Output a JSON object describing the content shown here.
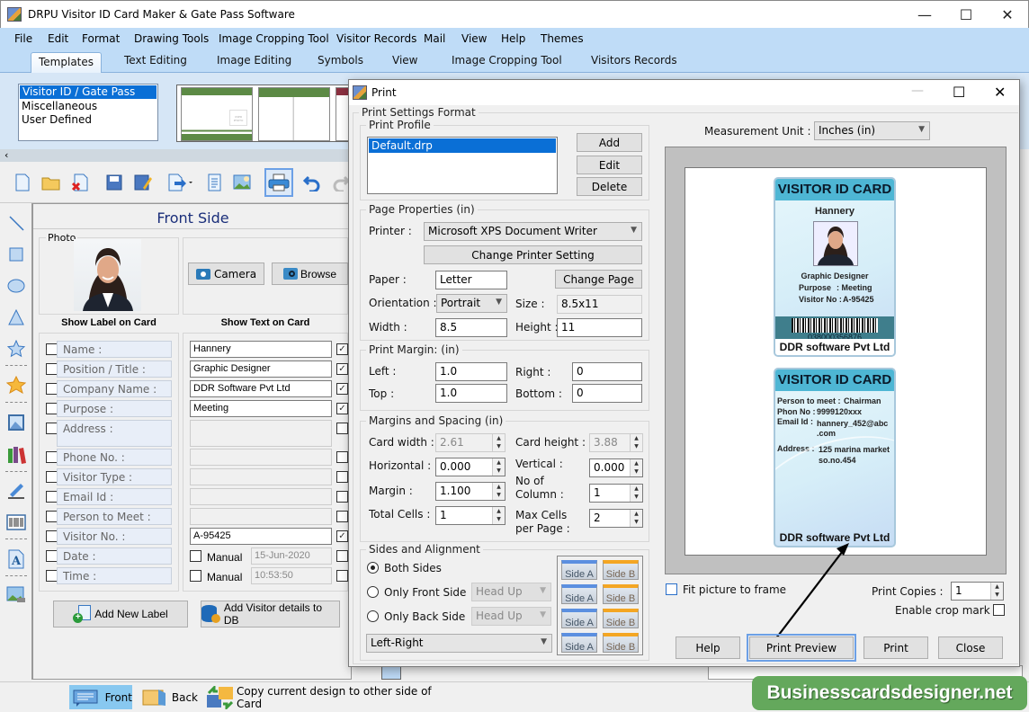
{
  "app": {
    "title": "DRPU Visitor ID Card Maker & Gate Pass Software",
    "window_controls": {
      "minimize": "—",
      "maximize": "☐",
      "close": "✕"
    }
  },
  "menu": [
    "File",
    "Edit",
    "Format",
    "Drawing Tools",
    "Image Cropping Tool",
    "Visitor Records",
    "Mail",
    "View",
    "Help",
    "Themes"
  ],
  "tabs": [
    {
      "label": "Templates",
      "active": true
    },
    {
      "label": "Text Editing"
    },
    {
      "label": "Image Editing"
    },
    {
      "label": "Symbols"
    },
    {
      "label": "View"
    },
    {
      "label": "Image Cropping Tool"
    },
    {
      "label": "Visitors Records"
    }
  ],
  "templates": {
    "categories": [
      "Visitor ID / Gate Pass",
      "Miscellaneous",
      "User Defined"
    ],
    "selected": "Visitor ID / Gate Pass",
    "thumb_text": "USER PHOTO"
  },
  "toolbar": [
    "new-icon",
    "open-icon",
    "close-doc-icon",
    "save-icon",
    "save-as-icon",
    "export-icon",
    "properties-icon",
    "image-icon",
    "print-icon",
    "undo-icon",
    "redo-icon"
  ],
  "left_tools": [
    "line-icon",
    "rectangle-icon",
    "ellipse-icon",
    "triangle-icon",
    "star-icon",
    "symbol-icon",
    "picture-icon",
    "library-icon",
    "signature-icon",
    "barcode-icon",
    "text-icon",
    "background-image-icon"
  ],
  "front_side": {
    "title": "Front Side",
    "photo_label": "Photo",
    "camera_label": "Camera",
    "browse_label": "Browse",
    "show_label_header": "Show Label on Card",
    "show_text_header": "Show Text on Card",
    "fields": [
      {
        "label": "Name :",
        "value": "Hannery",
        "show_label": false,
        "show_text": true,
        "enabled": true
      },
      {
        "label": "Position / Title :",
        "value": "Graphic Designer",
        "show_label": false,
        "show_text": true,
        "enabled": true
      },
      {
        "label": "Company Name :",
        "value": "DDR Software Pvt Ltd",
        "show_label": false,
        "show_text": true,
        "enabled": true
      },
      {
        "label": "Purpose :",
        "value": "Meeting",
        "show_label": false,
        "show_text": true,
        "enabled": true
      },
      {
        "label": "Address :",
        "value": "",
        "show_label": false,
        "show_text": false,
        "enabled": false
      },
      {
        "label": "Phone No. :",
        "value": "",
        "show_label": false,
        "show_text": false,
        "enabled": false
      },
      {
        "label": "Visitor Type :",
        "value": "",
        "show_label": false,
        "show_text": false,
        "enabled": false
      },
      {
        "label": "Email Id :",
        "value": "",
        "show_label": false,
        "show_text": false,
        "enabled": false
      },
      {
        "label": "Person to Meet :",
        "value": "",
        "show_label": false,
        "show_text": false,
        "enabled": false
      },
      {
        "label": "Visitor No. :",
        "value": "A-95425",
        "show_label": false,
        "show_text": true,
        "enabled": true
      },
      {
        "label": "Date :",
        "value": "15-Jun-2020",
        "manual_label": "Manual",
        "show_label": false,
        "show_text": false,
        "enabled": false
      },
      {
        "label": "Time :",
        "value": "10:53:50",
        "manual_label": "Manual",
        "show_label": false,
        "show_text": false,
        "enabled": false
      }
    ],
    "add_label_button": "Add New Label",
    "add_db_button": "Add Visitor details to DB"
  },
  "statusbar": {
    "front": "Front",
    "back": "Back",
    "copy": "Copy current design to other side of Card"
  },
  "print_dialog": {
    "title": "Print",
    "settings_format": "Print Settings Format",
    "profile": {
      "legend": "Print Profile",
      "items": [
        "Default.drp"
      ],
      "selected": "Default.drp",
      "add": "Add",
      "edit": "Edit",
      "delete": "Delete"
    },
    "page_properties": {
      "legend": "Page Properties  (in)",
      "printer_label": "Printer :",
      "printer": "Microsoft XPS Document Writer",
      "change_printer": "Change Printer Setting",
      "paper_label": "Paper :",
      "paper": "Letter",
      "change_page": "Change Page",
      "orientation_label": "Orientation :",
      "orientation": "Portrait",
      "size_label": "Size :",
      "size": "8.5x11",
      "width_label": "Width :",
      "width": "8.5",
      "height_label": "Height :",
      "height": "11"
    },
    "print_margin": {
      "legend": "Print Margin: (in)",
      "left_label": "Left :",
      "left": "1.0",
      "right_label": "Right :",
      "right": "0",
      "top_label": "Top :",
      "top": "1.0",
      "bottom_label": "Bottom :",
      "bottom": "0"
    },
    "spacing": {
      "legend": "Margins and Spacing  (in)",
      "card_width_label": "Card width :",
      "card_width": "2.61",
      "card_height_label": "Card height :",
      "card_height": "3.88",
      "horizontal_label": "Horizontal :",
      "horizontal": "0.000",
      "vertical_label": "Vertical :",
      "vertical": "0.000",
      "margin_label": "Margin :",
      "margin": "1.100",
      "columns_label": "No of Column :",
      "columns": "1",
      "total_cells_label": "Total Cells :",
      "total_cells": "1",
      "max_cells_label": "Max Cells per Page :",
      "max_cells": "2"
    },
    "sides": {
      "legend": "Sides and Alignment",
      "both": "Both Sides",
      "front_only": "Only Front Side",
      "back_only": "Only Back Side",
      "selected": "both",
      "head_up": "Head Up",
      "alignment": "Left-Right",
      "side_a": "Side A",
      "side_b": "Side B"
    },
    "measurement_label": "Measurement Unit :",
    "measurement": "Inches (in)",
    "fit_picture": "Fit picture to frame",
    "fit_checked": false,
    "copies_label": "Print Copies :",
    "copies": "1",
    "crop_mark": "Enable crop mark",
    "crop_checked": false,
    "buttons": {
      "help": "Help",
      "preview": "Print Preview",
      "print": "Print",
      "close": "Close"
    }
  },
  "card_preview": {
    "front": {
      "header": "VISITOR ID CARD",
      "name": "Hannery",
      "title": "Graphic Designer",
      "purpose_label": "Purpose",
      "purpose": "Meeting",
      "visitor_no_label": "Visitor No :",
      "visitor_no": "A-95425",
      "barcode": "038000356876",
      "company": "DDR software Pvt Ltd"
    },
    "back": {
      "header": "VISITOR ID CARD",
      "person_label": "Person to meet :",
      "person": "Chairman",
      "phone_label": "Phon No :",
      "phone": "9999120xxx",
      "email_label": "Email Id :",
      "email": "hannery_452@abc .com",
      "address_label": "Address :",
      "address": "125 marina market so.no.454",
      "company": "DDR software Pvt Ltd"
    }
  },
  "watermark": "Businesscardsdesigner.net",
  "colors": {
    "accent": "#0a6fd6",
    "ribbon": "#bfdcf7",
    "card_header": "#4eb6d4",
    "watermark": "#64a85c"
  }
}
